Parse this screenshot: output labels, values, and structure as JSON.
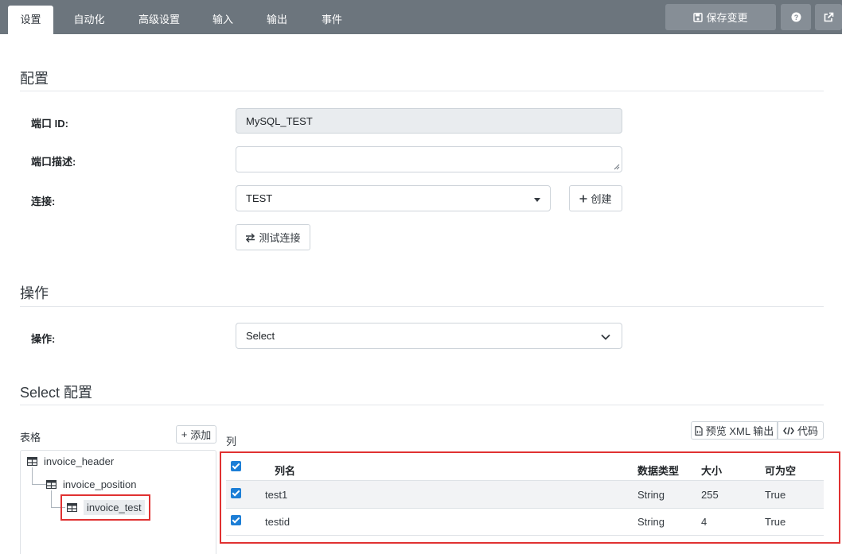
{
  "tabs": [
    {
      "label": "设置",
      "active": true
    },
    {
      "label": "自动化"
    },
    {
      "label": "高级设置"
    },
    {
      "label": "输入"
    },
    {
      "label": "输出"
    },
    {
      "label": "事件"
    }
  ],
  "toolbar": {
    "save_label": "保存变更",
    "help_icon": "question-circle-icon",
    "external_icon": "external-link-icon"
  },
  "config": {
    "title": "配置",
    "port_id_label": "端口 ID:",
    "port_id_value": "MySQL_TEST",
    "port_desc_label": "端口描述:",
    "port_desc_value": "",
    "connection_label": "连接:",
    "connection_value": "TEST",
    "create_label": "创建",
    "test_label": "测试连接"
  },
  "operation": {
    "title": "操作",
    "label": "操作:",
    "value": "Select"
  },
  "select_config": {
    "title": "Select 配置",
    "tables_label": "表格",
    "add_label": "添加",
    "columns_label": "列",
    "preview_label": "预览 XML 输出",
    "code_label": "代码",
    "tree": [
      {
        "label": "invoice_header",
        "level": 0
      },
      {
        "label": "invoice_position",
        "level": 1
      },
      {
        "label": "invoice_test",
        "level": 2,
        "selected": true
      }
    ],
    "table": {
      "headers": {
        "name": "列名",
        "type": "数据类型",
        "size": "大小",
        "nullable": "可为空"
      },
      "rows": [
        {
          "checked": true,
          "name": "test1",
          "type": "String",
          "size": "255",
          "nullable": "True"
        },
        {
          "checked": true,
          "name": "testid",
          "type": "String",
          "size": "4",
          "nullable": "True"
        }
      ]
    }
  },
  "colors": {
    "topbar": "#6c757d",
    "checkbox": "#1c7ed6",
    "highlight": "#e03131"
  }
}
